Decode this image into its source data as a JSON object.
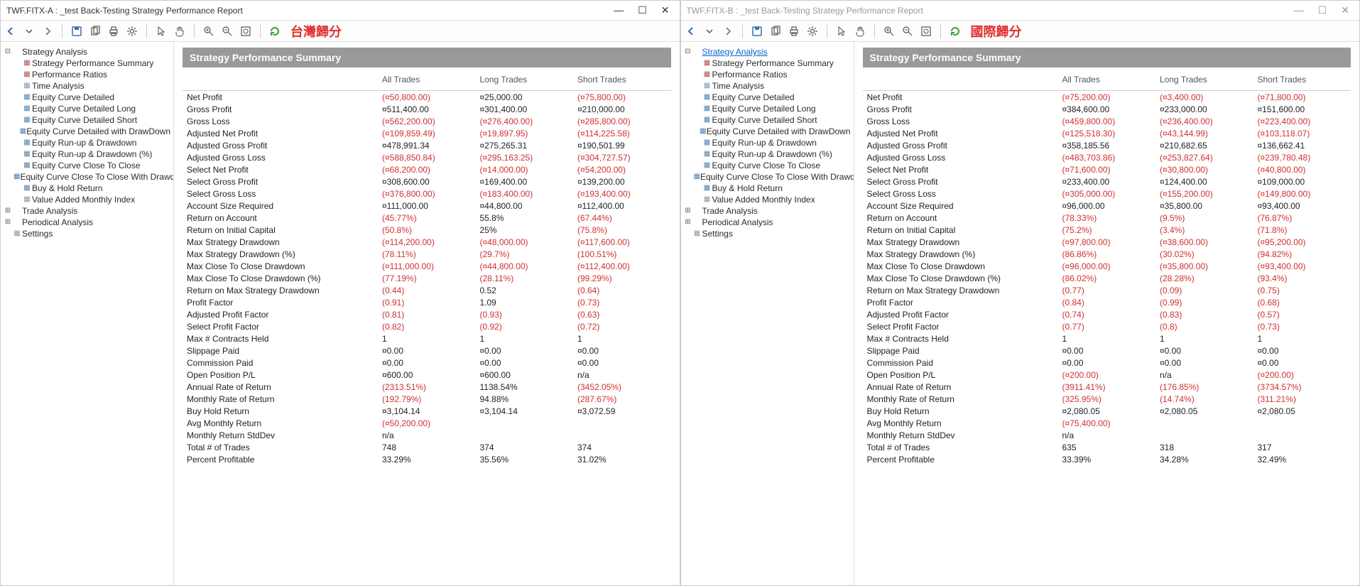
{
  "apps": [
    {
      "title": "TWF.FITX-A : _test Back-Testing Strategy Performance Report",
      "active": true,
      "toolbar_tag": "台灣歸分",
      "tree": {
        "root": "Strategy Analysis",
        "root_active": false,
        "items": [
          "Strategy Performance Summary",
          "Performance Ratios",
          "Time Analysis",
          "Equity Curve Detailed",
          "Equity Curve Detailed Long",
          "Equity Curve Detailed Short",
          "Equity Curve Detailed with DrawDown",
          "Equity Run-up & Drawdown",
          "Equity Run-up & Drawdown (%)",
          "Equity Curve Close To Close",
          "Equity Curve Close To Close With Drawdown",
          "Buy & Hold Return",
          "Value Added Monthly Index"
        ],
        "trade": "Trade Analysis",
        "periodical": "Periodical Analysis",
        "settings": "Settings"
      },
      "section_title": "Strategy Performance Summary",
      "columns": [
        "All Trades",
        "Long Trades",
        "Short Trades"
      ],
      "rows": [
        {
          "label": "Net Profit",
          "all": "(¤50,800.00)",
          "an": true,
          "long": "¤25,000.00",
          "ln": false,
          "short": "(¤75,800.00)",
          "sn": true
        },
        {
          "label": "Gross Profit",
          "all": "¤511,400.00",
          "an": false,
          "long": "¤301,400.00",
          "ln": false,
          "short": "¤210,000.00",
          "sn": false
        },
        {
          "label": "Gross Loss",
          "all": "(¤562,200.00)",
          "an": true,
          "long": "(¤276,400.00)",
          "ln": true,
          "short": "(¤285,800.00)",
          "sn": true
        },
        {
          "label": "Adjusted Net Profit",
          "all": "(¤109,859.49)",
          "an": true,
          "long": "(¤19,897.95)",
          "ln": true,
          "short": "(¤114,225.58)",
          "sn": true
        },
        {
          "label": "Adjusted Gross Profit",
          "all": "¤478,991.34",
          "an": false,
          "long": "¤275,265.31",
          "ln": false,
          "short": "¤190,501.99",
          "sn": false
        },
        {
          "label": "Adjusted Gross Loss",
          "all": "(¤588,850.84)",
          "an": true,
          "long": "(¤295,163.25)",
          "ln": true,
          "short": "(¤304,727.57)",
          "sn": true
        },
        {
          "label": "Select Net Profit",
          "all": "(¤68,200.00)",
          "an": true,
          "long": "(¤14,000.00)",
          "ln": true,
          "short": "(¤54,200.00)",
          "sn": true
        },
        {
          "label": "Select Gross Profit",
          "all": "¤308,600.00",
          "an": false,
          "long": "¤169,400.00",
          "ln": false,
          "short": "¤139,200.00",
          "sn": false
        },
        {
          "label": "Select Gross Loss",
          "all": "(¤376,800.00)",
          "an": true,
          "long": "(¤183,400.00)",
          "ln": true,
          "short": "(¤193,400.00)",
          "sn": true
        },
        {
          "label": "Account Size Required",
          "all": "¤111,000.00",
          "an": false,
          "long": "¤44,800.00",
          "ln": false,
          "short": "¤112,400.00",
          "sn": false
        },
        {
          "label": "Return on Account",
          "all": "(45.77%)",
          "an": true,
          "long": "55.8%",
          "ln": false,
          "short": "(67.44%)",
          "sn": true
        },
        {
          "label": "Return on Initial Capital",
          "all": "(50.8%)",
          "an": true,
          "long": "25%",
          "ln": false,
          "short": "(75.8%)",
          "sn": true
        },
        {
          "label": "Max Strategy Drawdown",
          "all": "(¤114,200.00)",
          "an": true,
          "long": "(¤48,000.00)",
          "ln": true,
          "short": "(¤117,600.00)",
          "sn": true
        },
        {
          "label": "Max Strategy Drawdown (%)",
          "all": "(78.11%)",
          "an": true,
          "long": "(29.7%)",
          "ln": true,
          "short": "(100.51%)",
          "sn": true
        },
        {
          "label": "Max Close To Close Drawdown",
          "all": "(¤111,000.00)",
          "an": true,
          "long": "(¤44,800.00)",
          "ln": true,
          "short": "(¤112,400.00)",
          "sn": true
        },
        {
          "label": "Max Close To Close Drawdown (%)",
          "all": "(77.19%)",
          "an": true,
          "long": "(28.11%)",
          "ln": true,
          "short": "(99.29%)",
          "sn": true
        },
        {
          "label": "Return on Max Strategy Drawdown",
          "all": "(0.44)",
          "an": true,
          "long": "0.52",
          "ln": false,
          "short": "(0.64)",
          "sn": true
        },
        {
          "label": "Profit Factor",
          "all": "(0.91)",
          "an": true,
          "long": "1.09",
          "ln": false,
          "short": "(0.73)",
          "sn": true
        },
        {
          "label": "Adjusted Profit Factor",
          "all": "(0.81)",
          "an": true,
          "long": "(0.93)",
          "ln": true,
          "short": "(0.63)",
          "sn": true
        },
        {
          "label": "Select Profit Factor",
          "all": "(0.82)",
          "an": true,
          "long": "(0.92)",
          "ln": true,
          "short": "(0.72)",
          "sn": true
        },
        {
          "label": "Max # Contracts Held",
          "all": "1",
          "an": false,
          "long": "1",
          "ln": false,
          "short": "1",
          "sn": false
        },
        {
          "label": "Slippage Paid",
          "all": "¤0.00",
          "an": false,
          "long": "¤0.00",
          "ln": false,
          "short": "¤0.00",
          "sn": false
        },
        {
          "label": "Commission Paid",
          "all": "¤0.00",
          "an": false,
          "long": "¤0.00",
          "ln": false,
          "short": "¤0.00",
          "sn": false
        },
        {
          "label": "Open Position P/L",
          "all": "¤600.00",
          "an": false,
          "long": "¤600.00",
          "ln": false,
          "short": "n/a",
          "sn": false
        },
        {
          "label": "Annual Rate of Return",
          "all": "(2313.51%)",
          "an": true,
          "long": "1138.54%",
          "ln": false,
          "short": "(3452.05%)",
          "sn": true
        },
        {
          "label": "Monthly Rate of Return",
          "all": "(192.79%)",
          "an": true,
          "long": "94.88%",
          "ln": false,
          "short": "(287.67%)",
          "sn": true
        },
        {
          "label": "Buy  Hold Return",
          "all": "¤3,104.14",
          "an": false,
          "long": "¤3,104.14",
          "ln": false,
          "short": "¤3,072.59",
          "sn": false
        },
        {
          "label": "Avg Monthly Return",
          "all": "(¤50,200.00)",
          "an": true,
          "long": "",
          "ln": false,
          "short": "",
          "sn": false
        },
        {
          "label": "Monthly Return StdDev",
          "all": "n/a",
          "an": false,
          "long": "",
          "ln": false,
          "short": "",
          "sn": false
        },
        {
          "label": "Total # of Trades",
          "all": "748",
          "an": false,
          "long": "374",
          "ln": false,
          "short": "374",
          "sn": false
        },
        {
          "label": "Percent Profitable",
          "all": "33.29%",
          "an": false,
          "long": "35.56%",
          "ln": false,
          "short": "31.02%",
          "sn": false
        }
      ]
    },
    {
      "title": "TWF.FITX-B : _test Back-Testing Strategy Performance Report",
      "active": false,
      "toolbar_tag": "國際歸分",
      "tree": {
        "root": "Strategy Analysis",
        "root_active": true,
        "items": [
          "Strategy Performance Summary",
          "Performance Ratios",
          "Time Analysis",
          "Equity Curve Detailed",
          "Equity Curve Detailed Long",
          "Equity Curve Detailed Short",
          "Equity Curve Detailed with DrawDown",
          "Equity Run-up & Drawdown",
          "Equity Run-up & Drawdown (%)",
          "Equity Curve Close To Close",
          "Equity Curve Close To Close With Drawdown",
          "Buy & Hold Return",
          "Value Added Monthly Index"
        ],
        "trade": "Trade Analysis",
        "periodical": "Periodical Analysis",
        "settings": "Settings"
      },
      "section_title": "Strategy Performance Summary",
      "columns": [
        "All Trades",
        "Long Trades",
        "Short Trades"
      ],
      "rows": [
        {
          "label": "Net Profit",
          "all": "(¤75,200.00)",
          "an": true,
          "long": "(¤3,400.00)",
          "ln": true,
          "short": "(¤71,800.00)",
          "sn": true
        },
        {
          "label": "Gross Profit",
          "all": "¤384,600.00",
          "an": false,
          "long": "¤233,000.00",
          "ln": false,
          "short": "¤151,600.00",
          "sn": false
        },
        {
          "label": "Gross Loss",
          "all": "(¤459,800.00)",
          "an": true,
          "long": "(¤236,400.00)",
          "ln": true,
          "short": "(¤223,400.00)",
          "sn": true
        },
        {
          "label": "Adjusted Net Profit",
          "all": "(¤125,518.30)",
          "an": true,
          "long": "(¤43,144.99)",
          "ln": true,
          "short": "(¤103,118.07)",
          "sn": true
        },
        {
          "label": "Adjusted Gross Profit",
          "all": "¤358,185.56",
          "an": false,
          "long": "¤210,682.65",
          "ln": false,
          "short": "¤136,662.41",
          "sn": false
        },
        {
          "label": "Adjusted Gross Loss",
          "all": "(¤483,703.86)",
          "an": true,
          "long": "(¤253,827.64)",
          "ln": true,
          "short": "(¤239,780.48)",
          "sn": true
        },
        {
          "label": "Select Net Profit",
          "all": "(¤71,600.00)",
          "an": true,
          "long": "(¤30,800.00)",
          "ln": true,
          "short": "(¤40,800.00)",
          "sn": true
        },
        {
          "label": "Select Gross Profit",
          "all": "¤233,400.00",
          "an": false,
          "long": "¤124,400.00",
          "ln": false,
          "short": "¤109,000.00",
          "sn": false
        },
        {
          "label": "Select Gross Loss",
          "all": "(¤305,000.00)",
          "an": true,
          "long": "(¤155,200.00)",
          "ln": true,
          "short": "(¤149,800.00)",
          "sn": true
        },
        {
          "label": "Account Size Required",
          "all": "¤96,000.00",
          "an": false,
          "long": "¤35,800.00",
          "ln": false,
          "short": "¤93,400.00",
          "sn": false
        },
        {
          "label": "Return on Account",
          "all": "(78.33%)",
          "an": true,
          "long": "(9.5%)",
          "ln": true,
          "short": "(76.87%)",
          "sn": true
        },
        {
          "label": "Return on Initial Capital",
          "all": "(75.2%)",
          "an": true,
          "long": "(3.4%)",
          "ln": true,
          "short": "(71.8%)",
          "sn": true
        },
        {
          "label": "Max Strategy Drawdown",
          "all": "(¤97,800.00)",
          "an": true,
          "long": "(¤38,600.00)",
          "ln": true,
          "short": "(¤95,200.00)",
          "sn": true
        },
        {
          "label": "Max Strategy Drawdown (%)",
          "all": "(86.86%)",
          "an": true,
          "long": "(30.02%)",
          "ln": true,
          "short": "(94.82%)",
          "sn": true
        },
        {
          "label": "Max Close To Close Drawdown",
          "all": "(¤96,000.00)",
          "an": true,
          "long": "(¤35,800.00)",
          "ln": true,
          "short": "(¤93,400.00)",
          "sn": true
        },
        {
          "label": "Max Close To Close Drawdown (%)",
          "all": "(86.02%)",
          "an": true,
          "long": "(28.28%)",
          "ln": true,
          "short": "(93.4%)",
          "sn": true
        },
        {
          "label": "Return on Max Strategy Drawdown",
          "all": "(0.77)",
          "an": true,
          "long": "(0.09)",
          "ln": true,
          "short": "(0.75)",
          "sn": true
        },
        {
          "label": "Profit Factor",
          "all": "(0.84)",
          "an": true,
          "long": "(0.99)",
          "ln": true,
          "short": "(0.68)",
          "sn": true
        },
        {
          "label": "Adjusted Profit Factor",
          "all": "(0.74)",
          "an": true,
          "long": "(0.83)",
          "ln": true,
          "short": "(0.57)",
          "sn": true
        },
        {
          "label": "Select Profit Factor",
          "all": "(0.77)",
          "an": true,
          "long": "(0.8)",
          "ln": true,
          "short": "(0.73)",
          "sn": true
        },
        {
          "label": "Max # Contracts Held",
          "all": "1",
          "an": false,
          "long": "1",
          "ln": false,
          "short": "1",
          "sn": false
        },
        {
          "label": "Slippage Paid",
          "all": "¤0.00",
          "an": false,
          "long": "¤0.00",
          "ln": false,
          "short": "¤0.00",
          "sn": false
        },
        {
          "label": "Commission Paid",
          "all": "¤0.00",
          "an": false,
          "long": "¤0.00",
          "ln": false,
          "short": "¤0.00",
          "sn": false
        },
        {
          "label": "Open Position P/L",
          "all": "(¤200.00)",
          "an": true,
          "long": "n/a",
          "ln": false,
          "short": "(¤200.00)",
          "sn": true
        },
        {
          "label": "Annual Rate of Return",
          "all": "(3911.41%)",
          "an": true,
          "long": "(176.85%)",
          "ln": true,
          "short": "(3734.57%)",
          "sn": true
        },
        {
          "label": "Monthly Rate of Return",
          "all": "(325.95%)",
          "an": true,
          "long": "(14.74%)",
          "ln": true,
          "short": "(311.21%)",
          "sn": true
        },
        {
          "label": "Buy  Hold Return",
          "all": "¤2,080.05",
          "an": false,
          "long": "¤2,080.05",
          "ln": false,
          "short": "¤2,080.05",
          "sn": false
        },
        {
          "label": "Avg Monthly Return",
          "all": "(¤75,400.00)",
          "an": true,
          "long": "",
          "ln": false,
          "short": "",
          "sn": false
        },
        {
          "label": "Monthly Return StdDev",
          "all": "n/a",
          "an": false,
          "long": "",
          "ln": false,
          "short": "",
          "sn": false
        },
        {
          "label": "Total # of Trades",
          "all": "635",
          "an": false,
          "long": "318",
          "ln": false,
          "short": "317",
          "sn": false
        },
        {
          "label": "Percent Profitable",
          "all": "33.39%",
          "an": false,
          "long": "34.28%",
          "ln": false,
          "short": "32.49%",
          "sn": false
        }
      ]
    }
  ]
}
